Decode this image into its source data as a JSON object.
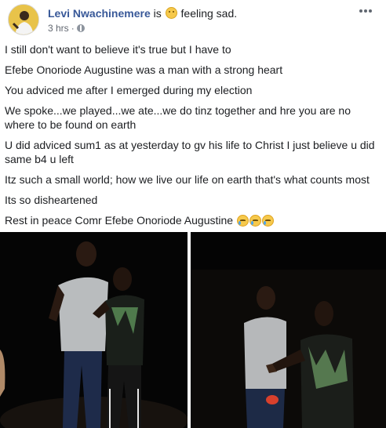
{
  "post": {
    "author": {
      "name": "Levi Nwachinemere",
      "is_text": "is",
      "feeling_text": "feeling sad."
    },
    "meta": {
      "time": "3 hrs",
      "separator": "·"
    },
    "icons": {
      "avatar": "profile-photo",
      "feeling": "sad-face-emoji",
      "privacy": "globe-icon",
      "more": "more-options-icon",
      "reaction": "crying-face-emoji"
    },
    "paragraphs": [
      "I still don't want to believe it's true but I have to",
      "Efebe Onoriode Augustine was a man with a strong heart",
      "You adviced me after I emerged during my election",
      "We spoke...we played...we ate...we do tinz together and hre you are no where to be found on earth",
      "U did adviced sum1 as at yesterday to gv his life to Christ I just believe u did same b4 u left",
      "Itz such a small world; how we live our life on earth that's what counts most",
      "Its so disheartened"
    ],
    "closing": "Rest in peace Comr Efebe Onoriode Augustine",
    "photos": [
      "two-men-at-night-photo-1",
      "two-men-at-night-photo-2"
    ],
    "colors": {
      "author": "#385898",
      "text": "#1c1e21",
      "meta": "#616770",
      "photo_bg": "#060606"
    }
  }
}
